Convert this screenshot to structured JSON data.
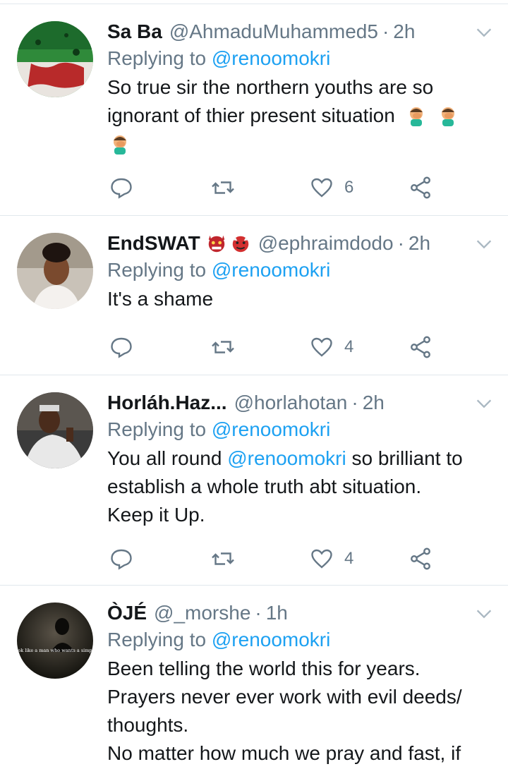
{
  "icons": {
    "reply": "reply-icon",
    "retweet": "retweet-icon",
    "like": "heart-icon",
    "share": "share-icon",
    "caret": "chevron-down-icon"
  },
  "colors": {
    "link": "#1da1f2",
    "muted": "#657786",
    "text": "#14171a",
    "divider": "#e1e8ed"
  },
  "tweets": [
    {
      "name": "Sa Ba",
      "handle": "@AhmaduMuhammed5",
      "time": "2h",
      "replying_prefix": "Replying to ",
      "replying_to": "@renoomokri",
      "text": "So true sir the northern youths are so ignorant of thier present situation",
      "emoji": "facepalm x3",
      "likes": "6"
    },
    {
      "name": "EndSWAT",
      "handle": "@ephraimdodo",
      "time": "2h",
      "replying_prefix": "Replying to ",
      "replying_to": "@renoomokri",
      "text": "It's a shame",
      "emoji": "devil-faces",
      "likes": "4"
    },
    {
      "name": "Horláh.Haz...",
      "handle": "@horlahotan",
      "time": "2h",
      "replying_prefix": "Replying to ",
      "replying_to": "@renoomokri",
      "text_prefix": "You all round ",
      "text_mention": "@renoomokri",
      "text_suffix": " so brilliant to establish a whole truth abt situation.",
      "text_line2": "Keep it Up.",
      "likes": "4"
    },
    {
      "name": "ÒJÉ",
      "handle": "@_morshe",
      "time": "1h",
      "replying_prefix": "Replying to ",
      "replying_to": "@renoomokri",
      "text_line1": "Been telling the world this for years.",
      "text_line2": "Prayers never ever work with evil deeds/",
      "text_line3": "thoughts.",
      "text_line4": "No matter how much we pray and fast, if",
      "avatar_caption": "\"Do I look like a man who wants a simple life?\""
    }
  ],
  "separator": "·"
}
